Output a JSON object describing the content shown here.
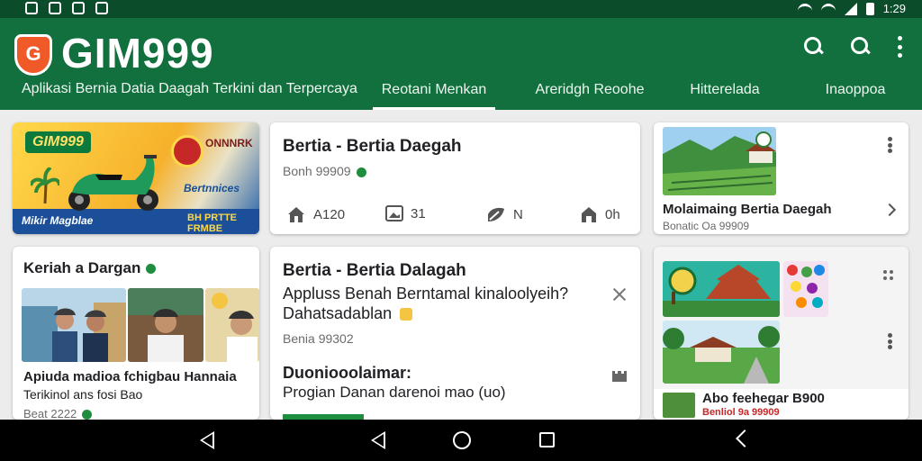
{
  "brand": {
    "logo_letter": "G",
    "name": "GIM999",
    "tagline": "Aplikasi Bernia Datia Daagah Terkini dan Terpercaya",
    "color_primary": "#11703e",
    "color_status": "#0b4d2a"
  },
  "status_bar": {
    "time": "1:29"
  },
  "tabs": [
    {
      "label": "Reotani Menkan",
      "active": true
    },
    {
      "label": "Areridgh Reoohe",
      "active": false
    },
    {
      "label": "Hitterelada",
      "active": false
    },
    {
      "label": "Inaoppoa",
      "active": false
    }
  ],
  "promo": {
    "tag": "GIM999",
    "badge_text": "ONNNRK",
    "line1": "Bertnnices",
    "line2": "BH PRTTE FRMBE",
    "bottom_text": "Mikir Magblae"
  },
  "card_featured": {
    "title": "Bertia - Bertia Daegah",
    "meta": "Bonh 99909",
    "stats": [
      {
        "icon": "home-icon",
        "value": "A120"
      },
      {
        "icon": "image-icon",
        "value": "31"
      },
      {
        "icon": "leaf-icon",
        "value": "N"
      },
      {
        "icon": "house-icon",
        "value": "0h"
      }
    ]
  },
  "card_village": {
    "title": "Molaimaing Bertia Daegah",
    "meta": "Bonatic Oa 99909"
  },
  "card_people": {
    "title": "Keriah a Dargan",
    "headline": "Apiuda madioa fchigbau Hannaia",
    "subline": "Terikinol ans fosi Bao",
    "meta": "Beat 2222"
  },
  "card_article": {
    "title": "Bertia - Bertia Dalagah",
    "body1": "Appluss Benah Berntamal kinaloolyeih?",
    "body2": "Dahatsadablan",
    "meta": "Benia 99302",
    "section_title": "Duoniooolaimar:",
    "section_body": "Progian Danan darenoi mao (uo)"
  },
  "card_gallery": {
    "title": "Abo feehegar B900",
    "meta": "Benliol 9a 99909"
  }
}
